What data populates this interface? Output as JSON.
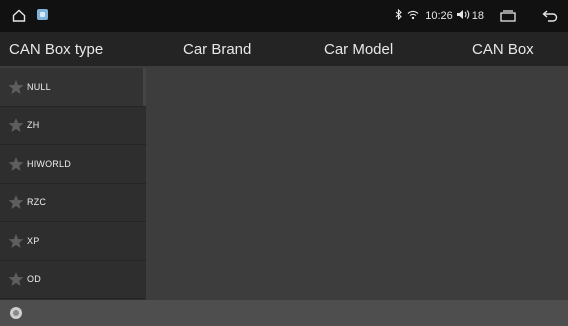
{
  "status_bar": {
    "time": "10:26",
    "volume": "18",
    "icons": [
      "home-icon",
      "image-thumbnail-icon",
      "bluetooth-icon",
      "wifi-signal-icon",
      "volume-icon",
      "recent-apps-icon",
      "back-icon"
    ]
  },
  "tabs": [
    {
      "label": "CAN Box type"
    },
    {
      "label": "Car Brand"
    },
    {
      "label": "Car Model"
    },
    {
      "label": "CAN Box"
    }
  ],
  "list": {
    "items": [
      {
        "label": "NULL"
      },
      {
        "label": "ZH"
      },
      {
        "label": "HIWORLD"
      },
      {
        "label": "RZC"
      },
      {
        "label": "XP"
      },
      {
        "label": "OD"
      }
    ]
  },
  "colors": {
    "background": "#3d3d3d",
    "status_bar": "#111111",
    "tab_bar": "#242424",
    "list": "#2e2e2e",
    "bottom_bar": "#4e4e4e"
  }
}
